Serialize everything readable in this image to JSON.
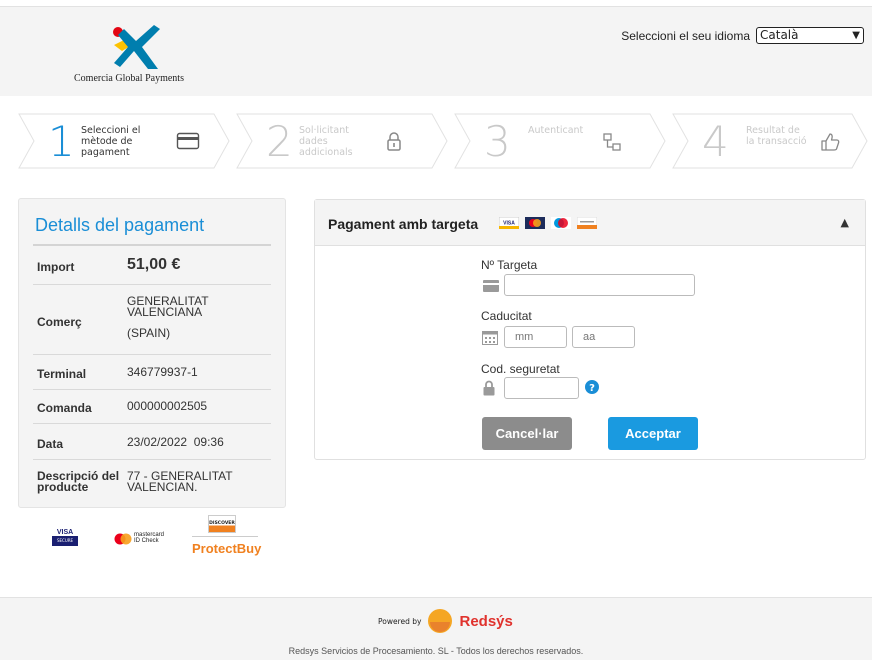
{
  "header": {
    "logo_text": "Comercia Global Payments",
    "language_label": "Seleccioni el seu idioma",
    "language_selected": "Català"
  },
  "steps": [
    {
      "number": "1",
      "label_lines": [
        "Seleccioni el",
        "mètode de",
        "pagament"
      ],
      "icon": "card-icon",
      "state": "active"
    },
    {
      "number": "2",
      "label_lines": [
        "Sol·licitant",
        "dades",
        "addicionals"
      ],
      "icon": "lock-icon",
      "state": "inactive"
    },
    {
      "number": "3",
      "label_lines": [
        "Autenticant"
      ],
      "icon": "network-icon",
      "state": "inactive"
    },
    {
      "number": "4",
      "label_lines": [
        "Resultat de",
        "la transacció"
      ],
      "icon": "thumbs-up-icon",
      "state": "inactive"
    }
  ],
  "details": {
    "title": "Detalls del pagament",
    "import_label": "Import",
    "import_value": "51,00 €",
    "merchant_label": "Comerç",
    "merchant_value_lines": [
      "GENERALITAT",
      "VALENCIANA",
      "(SPAIN)"
    ],
    "terminal_label": "Terminal",
    "terminal_value": "346779937-1",
    "order_label": "Comanda",
    "order_value": "000000002505",
    "date_label": "Data",
    "date_value": "23/02/2022  09:36",
    "description_label_lines": [
      "Descripció del",
      "producte"
    ],
    "description_value_lines": [
      "77 - GENERALITAT",
      "VALENCIAN."
    ]
  },
  "brands": {
    "visa": "VISA",
    "visa_sub": "SECURE",
    "mastercard": "mastercard",
    "mastercard_sub": "ID Check",
    "discover": "DISCOVER",
    "protectbuy": "ProtectBuy"
  },
  "payment": {
    "title": "Pagament amb targeta",
    "card_number_label": "Nº Targeta",
    "card_number_value": "",
    "expiry_label": "Caducitat",
    "month_placeholder": "mm",
    "year_placeholder": "aa",
    "cvv_label": "Cod. seguretat",
    "cvv_value": "",
    "cancel_label": "Cancel·lar",
    "accept_label": "Acceptar"
  },
  "footer": {
    "powered_by": "Powered by",
    "brand": "Redsýs",
    "copyright": "Redsys Servicios de Procesamiento. SL - Todos los derechos reservados."
  },
  "colors": {
    "accent": "#1a8ed6",
    "button_accept": "#1a9ae0",
    "button_cancel": "#8c8c8c",
    "panel_bg": "#f4f4f4"
  }
}
